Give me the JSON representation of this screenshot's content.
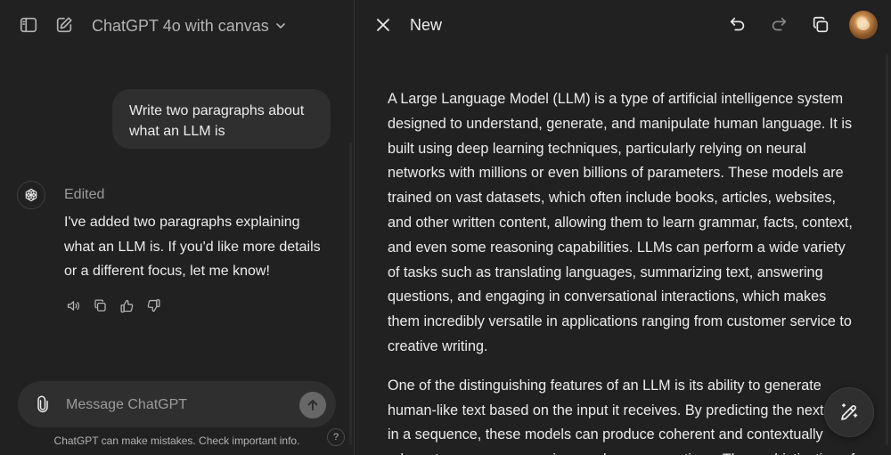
{
  "window": {
    "model_name": "ChatGPT 4o with canvas"
  },
  "chat": {
    "user_message": "Write two paragraphs about what an LLM is",
    "assistant": {
      "status": "Edited",
      "message": "I've added two paragraphs explaining what an LLM is. If you'd like more details or a different focus, let me know!"
    }
  },
  "composer": {
    "placeholder": "Message ChatGPT",
    "value": ""
  },
  "footer": {
    "disclaimer": "ChatGPT can make mistakes. Check important info.",
    "help_label": "?"
  },
  "canvas": {
    "title": "New",
    "paragraphs": [
      "A Large Language Model (LLM) is a type of artificial intelligence system designed to understand, generate, and manipulate human language. It is built using deep learning techniques, particularly relying on neural networks with millions or even billions of parameters. These models are trained on vast datasets, which often include books, articles, websites, and other written content, allowing them to learn grammar, facts, context, and even some reasoning capabilities. LLMs can perform a wide variety of tasks such as translating languages, summarizing text, answering questions, and engaging in conversational interactions, which makes them incredibly versatile in applications ranging from customer service to creative writing.",
      "One of the distinguishing features of an LLM is its ability to generate human-like text based on the input it receives. By predicting the next word in a sequence, these models can produce coherent and contextually relevant responses, even in complex conversations. The sophistication of"
    ]
  },
  "icons": {
    "sidebar": "sidebar-toggle-icon",
    "new_chat": "new-chat-icon",
    "chevron": "chevron-down-icon",
    "assistant": "openai-logo-icon",
    "read_aloud": "speaker-icon",
    "copy": "copy-icon",
    "thumbs_up": "thumbs-up-icon",
    "thumbs_down": "thumbs-down-icon",
    "attach": "paperclip-icon",
    "send": "arrow-up-icon",
    "close": "close-icon",
    "undo": "undo-icon",
    "redo": "redo-icon",
    "canvas_copy": "copy-icon",
    "edit": "pencil-sparkle-icon"
  },
  "colors": {
    "background": "#212121",
    "bubble": "#2f2f2f",
    "text": "#ececec",
    "muted": "#9b9b9b",
    "send_button": "#676767"
  }
}
